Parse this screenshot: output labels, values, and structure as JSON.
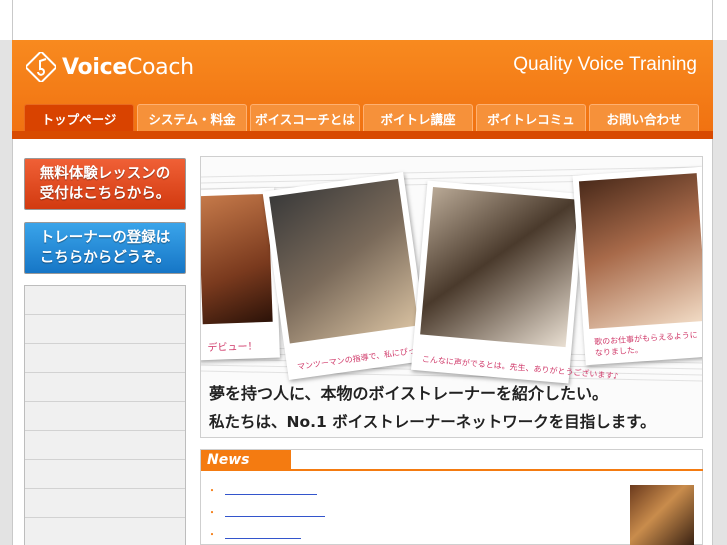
{
  "brand": {
    "name_bold": "Voice",
    "name_regular": "Coach",
    "tagline": "Quality Voice Training"
  },
  "colors": {
    "brand_orange": "#f47b11",
    "nav_active": "#d94300",
    "banner_red": "#d23a10",
    "banner_blue": "#1676c6"
  },
  "nav": {
    "items": [
      {
        "label": "トップページ"
      },
      {
        "label": "システム・料金"
      },
      {
        "label": "ボイスコーチとは"
      },
      {
        "label": "ボイトレ講座"
      },
      {
        "label": "ボイトレコミュ"
      },
      {
        "label": "お問い合わせ"
      }
    ]
  },
  "sidebar": {
    "banner_trial": {
      "line1": "無料体験レッスンの",
      "line2": "受付はこちらから。"
    },
    "banner_trainer": {
      "line1": "トレーナーの登録は",
      "line2": "こちらからどうぞ。"
    }
  },
  "hero": {
    "caption_1": "デビュー！",
    "caption_2": "マンツーマンの指導で、私にぴったりのレッスン",
    "caption_3": "こんなに声がでるとは。先生、ありがとうございます♪",
    "caption_4": "歌のお仕事がもらえるようになりました。",
    "headline_1": "夢を持つ人に、本物のボイストレーナーを紹介したい。",
    "headline_2": "私たちは、No.1 ボイストレーナーネットワークを目指します。"
  },
  "news": {
    "title": "News",
    "bullet": "・"
  }
}
